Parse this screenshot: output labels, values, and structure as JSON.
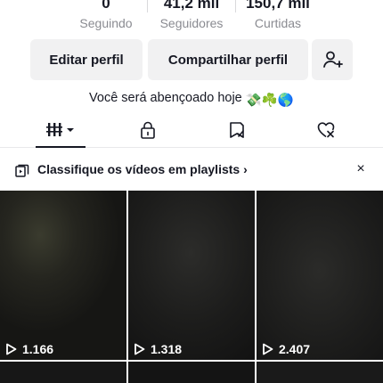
{
  "stats": {
    "following": {
      "value": "0",
      "label": "Seguindo"
    },
    "followers": {
      "value": "41,2 mil",
      "label": "Seguidores"
    },
    "likes": {
      "value": "150,7 mil",
      "label": "Curtidas"
    }
  },
  "actions": {
    "edit_label": "Editar perfil",
    "share_label": "Compartilhar perfil"
  },
  "bio": {
    "text": "Você será abençoado hoje ",
    "emojis": "💸☘️🌎"
  },
  "tabs": [
    {
      "icon": "grid-videos-icon",
      "active": true
    },
    {
      "icon": "lock-icon",
      "active": false
    },
    {
      "icon": "saved-icon",
      "active": false
    },
    {
      "icon": "liked-icon",
      "active": false
    }
  ],
  "banner": {
    "text": "Classifique os vídeos em playlists",
    "chevron": "›",
    "close": "×"
  },
  "videos": [
    {
      "views": "1.166"
    },
    {
      "views": "1.318"
    },
    {
      "views": "2.407"
    }
  ],
  "colors": {
    "text": "#161823",
    "muted": "#8a8b91",
    "button_bg": "#f1f1f2"
  }
}
